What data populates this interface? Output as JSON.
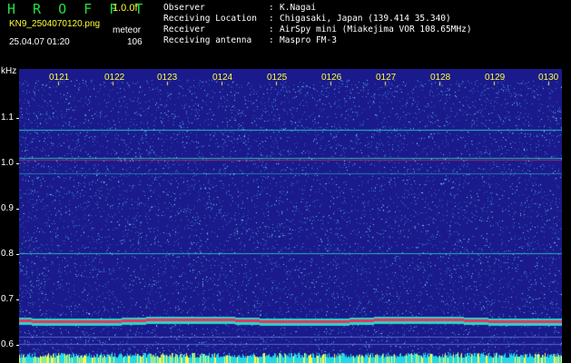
{
  "header": {
    "title": "H R O F F T",
    "version": "1.0.0f",
    "filename": "KN9_2504070120.png",
    "mode": "meteor",
    "datetime": "25.04.07 01:20",
    "count": "106"
  },
  "info": [
    {
      "label": "Observer",
      "value": "K.Nagai"
    },
    {
      "label": "Receiving Location",
      "value": "Chigasaki, Japan (139.414 35.340)"
    },
    {
      "label": "Receiver",
      "value": "AirSpy mini (Miakejima VOR 108.65MHz)"
    },
    {
      "label": "Receiving antenna",
      "value": "Maspro FM-3"
    }
  ],
  "info_separator": ":",
  "plot": {
    "unit": "kHz",
    "time_labels": [
      "0121",
      "0122",
      "0123",
      "0124",
      "0125",
      "0126",
      "0127",
      "0128",
      "0129",
      "0130"
    ],
    "y_labels": [
      "1.1",
      "1.0",
      "0.9",
      "0.8",
      "0.7",
      "0.6"
    ],
    "colors": {
      "background": "#1a1a8c",
      "noise": "#3e8cd4",
      "line": "#2ad6c8",
      "hot": "#e8355a",
      "axis_text": "#ffff33"
    }
  }
}
